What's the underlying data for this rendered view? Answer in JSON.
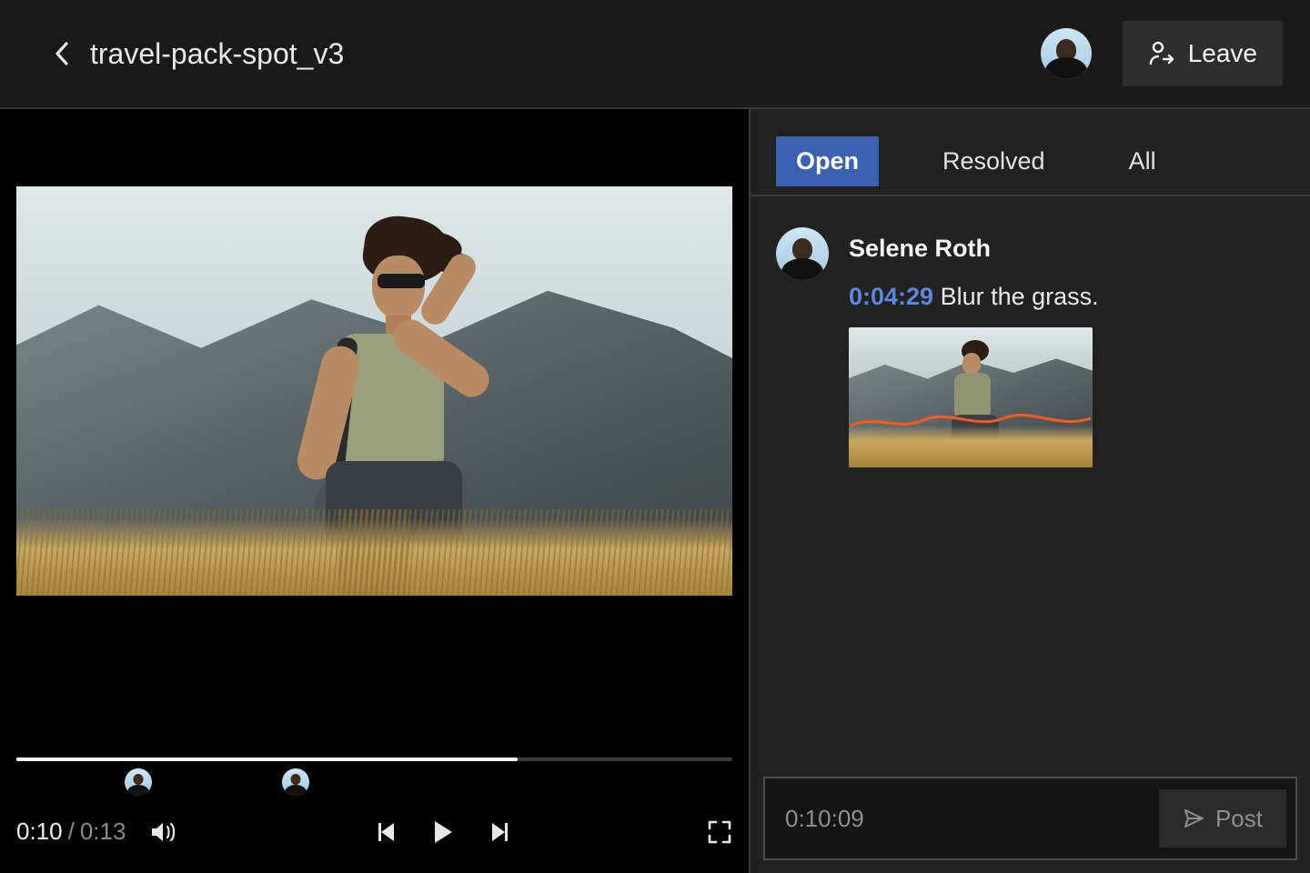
{
  "header": {
    "title": "travel-pack-spot_v3",
    "leave_label": "Leave"
  },
  "player": {
    "current_time": "0:10",
    "total_time": "0:13",
    "progress_percent": 70,
    "markers": [
      {
        "position_percent": 17
      },
      {
        "position_percent": 39
      }
    ]
  },
  "comments": {
    "tabs": [
      {
        "label": "Open",
        "active": true
      },
      {
        "label": "Resolved",
        "active": false
      },
      {
        "label": "All",
        "active": false
      }
    ],
    "items": [
      {
        "author": "Selene Roth",
        "timecode": "0:04:29",
        "text": "Blur the grass."
      }
    ]
  },
  "composer": {
    "timecode": "0:10:09",
    "post_label": "Post"
  }
}
